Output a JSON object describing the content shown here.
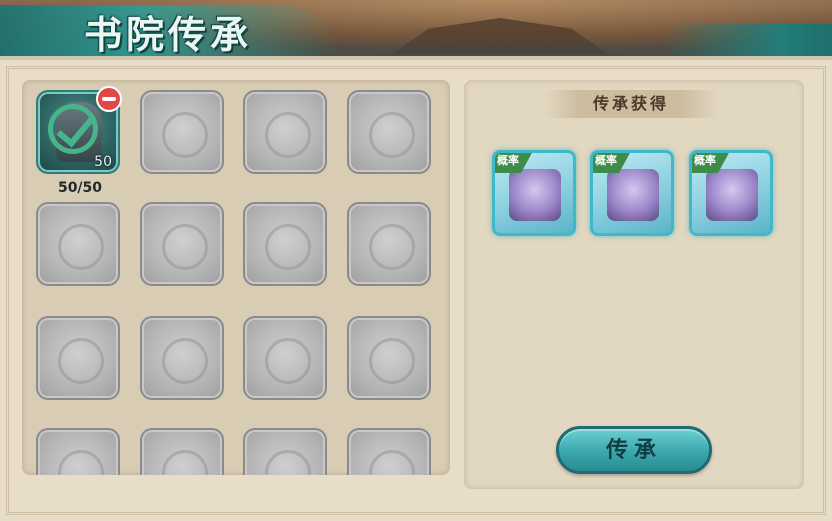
{
  "header": {
    "title": "书院传承"
  },
  "inventory": {
    "first_item": {
      "count": "50",
      "label": "50/50"
    }
  },
  "reward_panel": {
    "title": "传承获得",
    "items": [
      {
        "tag": "概率"
      },
      {
        "tag": "概率"
      },
      {
        "tag": "概率"
      }
    ]
  },
  "actions": {
    "inherit_label": "传承"
  },
  "colors": {
    "accent": "#3aa7ad",
    "panel": "#d9ccb4",
    "slot": "#b4b4b4",
    "remove": "#e04848",
    "check": "#46b58a"
  }
}
